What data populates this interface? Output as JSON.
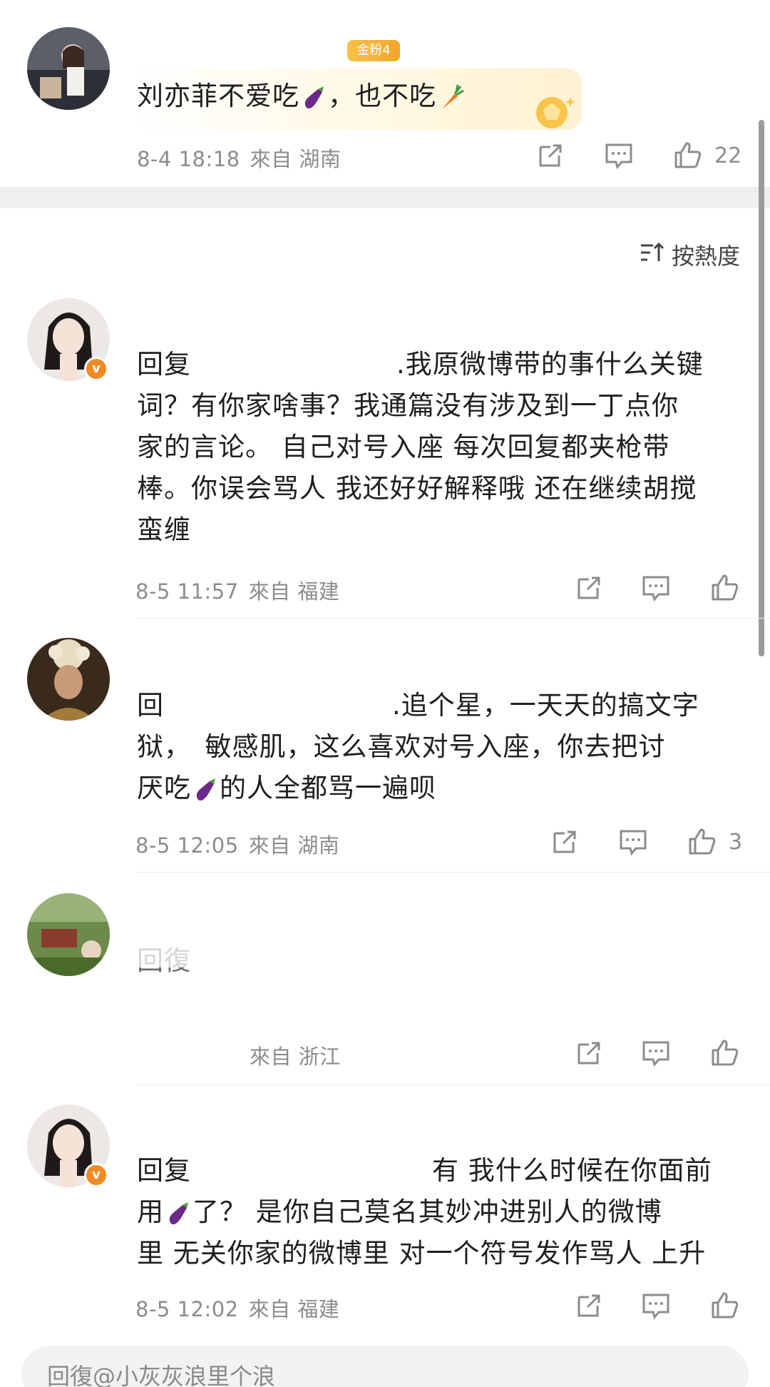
{
  "top_comment": {
    "badge": "金粉4",
    "text_part1": "刘亦菲不爱吃",
    "text_part2": "，也不吃",
    "time": "8-4 18:18",
    "source": "來自 湖南",
    "likes": "22"
  },
  "sort": {
    "label": "按熱度"
  },
  "comments": [
    {
      "line1_prefix": "回复",
      "line1_suffix": ".我原微博带的事什么关键",
      "line2": "词？有你家啥事？我通篇没有涉及到一丁点你",
      "line3": "家的言论。  自己对号入座 每次回复都夹枪带",
      "line4": "棒。你误会骂人 我还好好解释哦 还在继续胡搅",
      "line5": "蛮缠",
      "time": "8-5 11:57",
      "source": "來自 福建",
      "likes": ""
    },
    {
      "line1_prefix": "回",
      "line1_suffix": ".追个星，一天天的搞文字",
      "line2": "狱，　敏感肌，这么喜欢对号入座，你去把讨",
      "line3_prefix": "厌吃",
      "line3_suffix": "的人全都骂一遍呗",
      "time": "8-5 12:05",
      "source": "來自 湖南",
      "likes": "3"
    },
    {
      "line1": "回復",
      "source": "來自 浙江"
    },
    {
      "line1_prefix": "回复",
      "line1_suffix": "有 我什么时候在你面前",
      "line2_prefix": "用",
      "line2_suffix": "了？  是你自己莫名其妙冲进别人的微博",
      "line3": "里 无关你家的微博里 对一个符号发作骂人 上升",
      "time": "8-5 12:02",
      "source": "來自 福建"
    }
  ],
  "reply_box": {
    "placeholder": "回復@小灰灰浪里个浪"
  },
  "icons": [
    "share-icon",
    "comment-icon",
    "like-icon",
    "sort-icon",
    "eggplant-emoji",
    "carrot-emoji",
    "verified-icon"
  ],
  "colors": {
    "accent_orange": "#f08a24",
    "meta_gray": "#8c8c8c",
    "badge_gold": "#f3b53c"
  }
}
